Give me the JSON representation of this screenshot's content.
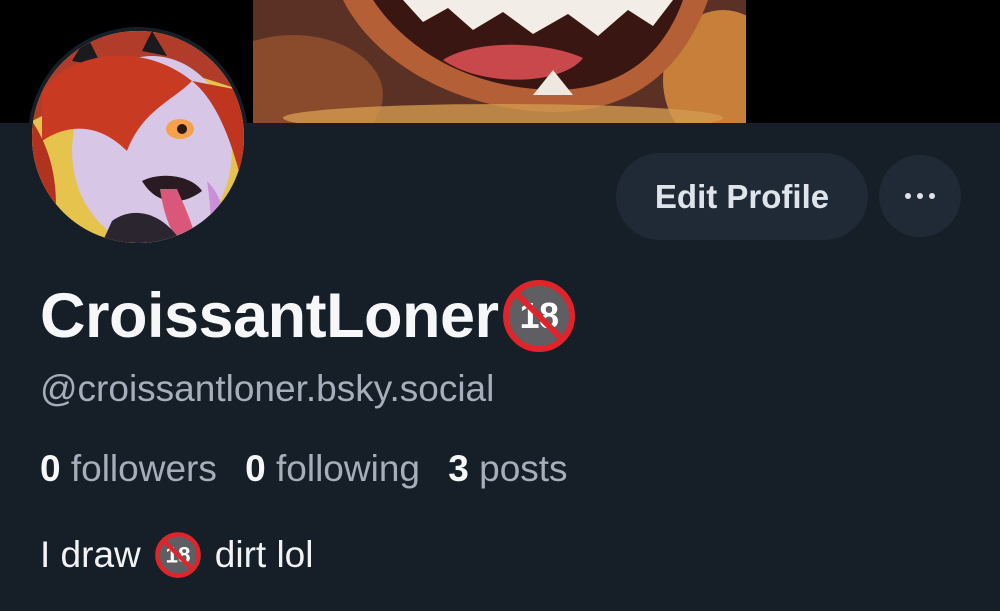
{
  "profile": {
    "display_name": "CroissantLoner",
    "handle": "@croissantloner.bsky.social",
    "bio": {
      "before": "I draw",
      "after": "dirt lol"
    },
    "avatar_icon": "anime-character-avatar",
    "banner_icon": "cartoon-mouth-banner",
    "badge_icon": "no-under-18-icon"
  },
  "stats": {
    "followers_count": "0",
    "followers_label": "followers",
    "following_count": "0",
    "following_label": "following",
    "posts_count": "3",
    "posts_label": "posts"
  },
  "actions": {
    "edit_profile_label": "Edit Profile",
    "more_icon": "ellipsis-icon"
  },
  "colors": {
    "background": "#161e27",
    "button_bg": "#1f2a36",
    "primary_text": "#f5f7f9",
    "secondary_text": "#a5afbb",
    "badge_red": "#e0242b"
  }
}
